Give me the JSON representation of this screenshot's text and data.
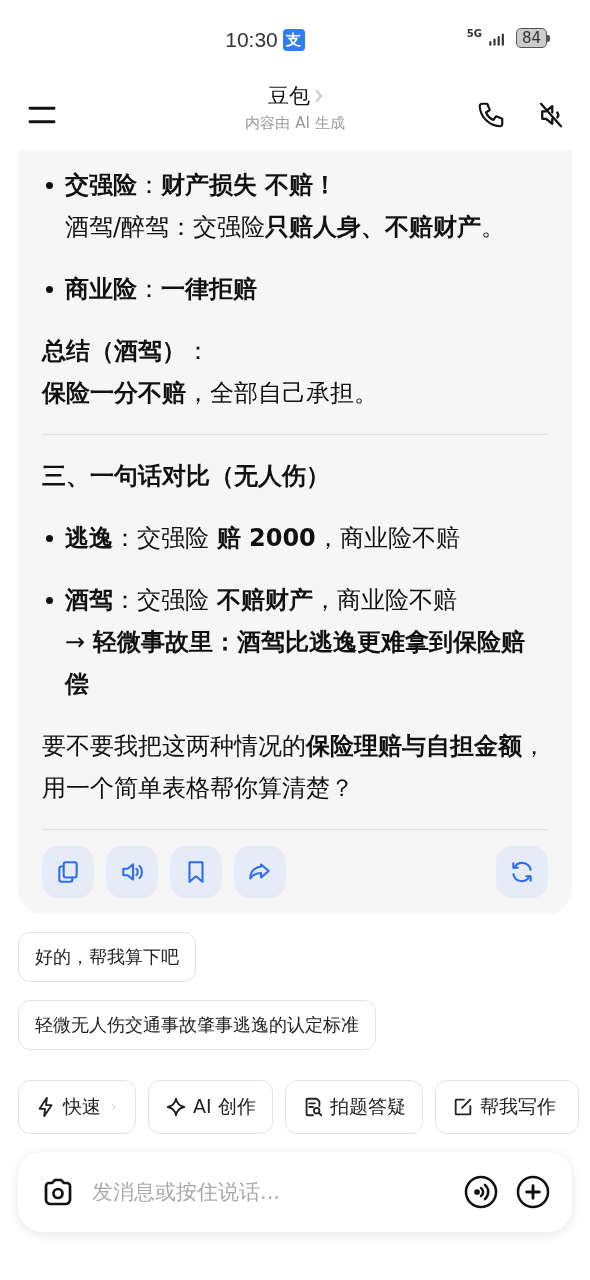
{
  "status_bar": {
    "time": "10:30",
    "app_badge": "支",
    "network": "5G",
    "battery": "84"
  },
  "header": {
    "title": "豆包",
    "subtitle": "内容由 AI 生成"
  },
  "message": {
    "blocks": [
      {
        "kind": "bullet",
        "lines": [
          "**交强险**：**财产损失 不赔！**",
          "酒驾/醉驾：交强险**只赔人身、不赔财产**。"
        ]
      },
      {
        "kind": "bullet",
        "lines": [
          "**商业险**：**一律拒赔**"
        ]
      },
      {
        "kind": "para",
        "lines": [
          "**总结（酒驾）**：",
          "**保险一分不赔**，全部自己承担。"
        ]
      },
      {
        "kind": "divider"
      },
      {
        "kind": "heading",
        "lines": [
          "三、一句话对比（无人伤）"
        ]
      },
      {
        "kind": "bullet",
        "lines": [
          "**逃逸**：交强险 **赔 2000**，商业险不赔"
        ]
      },
      {
        "kind": "bullet",
        "lines": [
          "**酒驾**：交强险 **不赔财产**，商业险不赔",
          "→ **轻微事故里：酒驾比逃逸更难拿到保险赔偿**"
        ]
      },
      {
        "kind": "para",
        "lines": [
          "要不要我把这两种情况的**保险理赔与自担金额**，用一个简单表格帮你算清楚？"
        ]
      },
      {
        "kind": "divider"
      }
    ],
    "actions": [
      {
        "kind": "copy"
      },
      {
        "kind": "speaker"
      },
      {
        "kind": "bookmark"
      },
      {
        "kind": "share"
      },
      {
        "kind": "regenerate"
      }
    ]
  },
  "suggestions": [
    "好的，帮我算下吧",
    "轻微无人伤交通事故肇事逃逸的认定标准"
  ],
  "shortcuts": [
    {
      "kind": "bolt",
      "label": "快速",
      "chevron": true
    },
    {
      "kind": "sparkle",
      "label": "AI 创作",
      "chevron": false
    },
    {
      "kind": "search-doc",
      "label": "拍题答疑",
      "chevron": false
    },
    {
      "kind": "edit",
      "label": "帮我写作",
      "chevron": false
    }
  ],
  "input": {
    "placeholder": "发消息或按住说话..."
  }
}
